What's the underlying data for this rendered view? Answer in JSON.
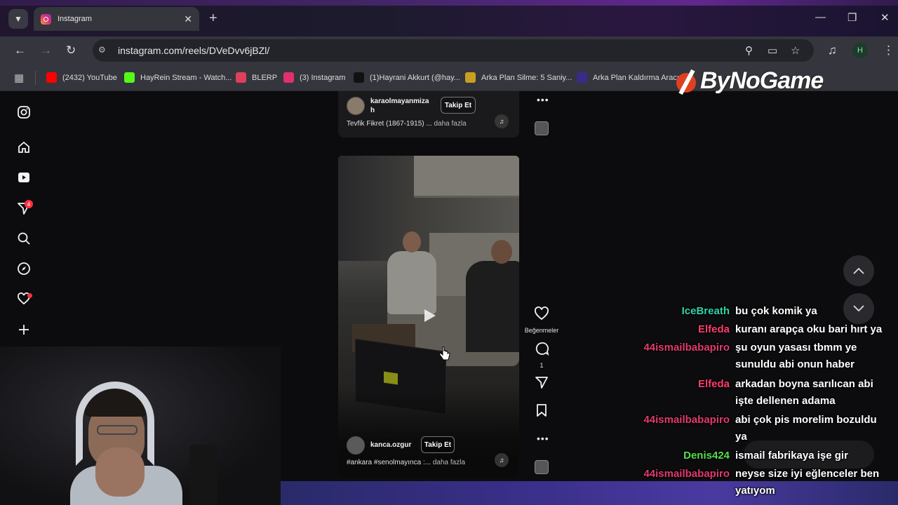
{
  "browser": {
    "tab_title": "Instagram",
    "url": "instagram.com/reels/DVeDvv6jBZl/",
    "profile_initial": "H",
    "bookmarks": [
      {
        "label": "(2432) YouTube",
        "color": "#ff0000"
      },
      {
        "label": "HayRein Stream - Watch...",
        "color": "#53fc18"
      },
      {
        "label": "BLERP",
        "color": "#e0405a"
      },
      {
        "label": "(3) Instagram",
        "color": "#e1306c"
      },
      {
        "label": "(1)Hayrani Akkurt (@hay...",
        "color": "#111111"
      },
      {
        "label": "Arka Plan Silme: 5 Saniy...",
        "color": "#c8a020"
      },
      {
        "label": "Arka Plan Kaldırma Aracı...",
        "color": "#3a2a8a"
      }
    ]
  },
  "overlay": {
    "logo_text": "ByNoGame"
  },
  "sidebar": {
    "messages_badge": "4"
  },
  "prev_reel": {
    "username": "karaolmayanmiza\nh",
    "follow_label": "Takip Et",
    "caption": "Tevfik Fikret (1867-1915) ...",
    "more_label": "daha fazla"
  },
  "reel": {
    "username": "kanca.ozgur",
    "follow_label": "Takip Et",
    "caption": "#ankara #senolmayınca :...",
    "more_label": "daha fazla",
    "like_label": "Beğenmeler",
    "comment_count": "1"
  },
  "chat": [
    {
      "user": "IceBreath",
      "color": "#2fd6a8",
      "text": "bu çok komik ya"
    },
    {
      "user": "Elfeda",
      "color": "#ff3d6e",
      "text": "kuranı arapça oku bari hırt ya"
    },
    {
      "user": "44ismailbabapiro",
      "color": "#e23a6e",
      "text": "şu oyun yasası tbmm ye sunuldu abi onun haber"
    },
    {
      "user": "Elfeda",
      "color": "#ff3d6e",
      "text": "arkadan boyna sarılıcan abi işte dellenen adama"
    },
    {
      "user": "44ismailbabapiro",
      "color": "#e23a6e",
      "text": "abi çok pis morelim bozuldu ya"
    },
    {
      "user": "Denis424",
      "color": "#54e04a",
      "text": "ismail fabrikaya işe gir"
    },
    {
      "user": "44ismailbabapiro",
      "color": "#e23a6e",
      "text": "neyse size iyi eğlenceler ben yatıyom"
    }
  ]
}
